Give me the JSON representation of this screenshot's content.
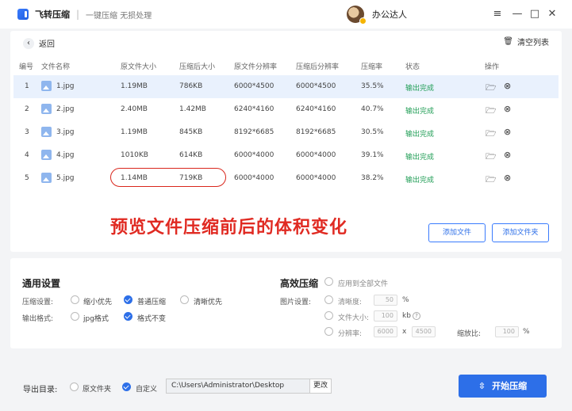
{
  "app": {
    "name": "飞转压缩",
    "slogan": "一键压缩 无损处理",
    "user_name": "办公达人"
  },
  "toolbar": {
    "back_label": "返回",
    "clear_label": "清空列表"
  },
  "table": {
    "headers": [
      "编号",
      "文件名称",
      "原文件大小",
      "压缩后大小",
      "原文件分辨率",
      "压缩后分辨率",
      "压缩率",
      "状态",
      "操作"
    ],
    "rows": [
      {
        "no": "1",
        "name": "1.jpg",
        "orig_size": "1.19MB",
        "new_size": "786KB",
        "orig_res": "6000*4500",
        "new_res": "6000*4500",
        "ratio": "35.5%",
        "status": "输出完成"
      },
      {
        "no": "2",
        "name": "2.jpg",
        "orig_size": "2.40MB",
        "new_size": "1.42MB",
        "orig_res": "6240*4160",
        "new_res": "6240*4160",
        "ratio": "40.7%",
        "status": "输出完成"
      },
      {
        "no": "3",
        "name": "3.jpg",
        "orig_size": "1.19MB",
        "new_size": "845KB",
        "orig_res": "8192*6685",
        "new_res": "8192*6685",
        "ratio": "30.5%",
        "status": "输出完成"
      },
      {
        "no": "4",
        "name": "4.jpg",
        "orig_size": "1010KB",
        "new_size": "614KB",
        "orig_res": "6000*4000",
        "new_res": "6000*4000",
        "ratio": "39.1%",
        "status": "输出完成"
      },
      {
        "no": "5",
        "name": "5.jpg",
        "orig_size": "1.14MB",
        "new_size": "719KB",
        "orig_res": "6000*4000",
        "new_res": "6000*4000",
        "ratio": "38.2%",
        "status": "输出完成"
      }
    ]
  },
  "annotation": {
    "caption": "预览文件压缩前后的体积变化"
  },
  "actions": {
    "add_file": "添加文件",
    "add_folder": "添加文件夹"
  },
  "general_settings": {
    "title": "通用设置",
    "compress_label": "压缩设置:",
    "compress_options": [
      "缩小优先",
      "普通压缩",
      "清晰优先"
    ],
    "compress_selected": "普通压缩",
    "format_label": "输出格式:",
    "format_options": [
      "jpg格式",
      "格式不变"
    ],
    "format_selected": "格式不变"
  },
  "advanced": {
    "title": "高效压缩",
    "apply_all": "应用到全部文件",
    "image_label": "图片设置:",
    "clarity_label": "清晰度:",
    "clarity_value": "50",
    "clarity_unit": "%",
    "filesize_label": "文件大小:",
    "filesize_value": "100",
    "filesize_unit": "kb",
    "help": "?",
    "resolution_label": "分辨率:",
    "res_w": "6000",
    "res_x": "x",
    "res_h": "4500",
    "scale_label": "缩放比:",
    "scale_value": "100",
    "scale_unit": "%"
  },
  "export": {
    "label": "导出目录:",
    "option_source": "原文件夹",
    "option_custom": "自定义",
    "selected": "自定义",
    "path": "C:\\Users\\Administrator\\Desktop",
    "change": "更改"
  },
  "start": {
    "label": "开始压缩",
    "icon": "compress-icon"
  },
  "colors": {
    "accent": "#2d6fe8",
    "success": "#1f9d55",
    "annotation": "#e02a22"
  }
}
